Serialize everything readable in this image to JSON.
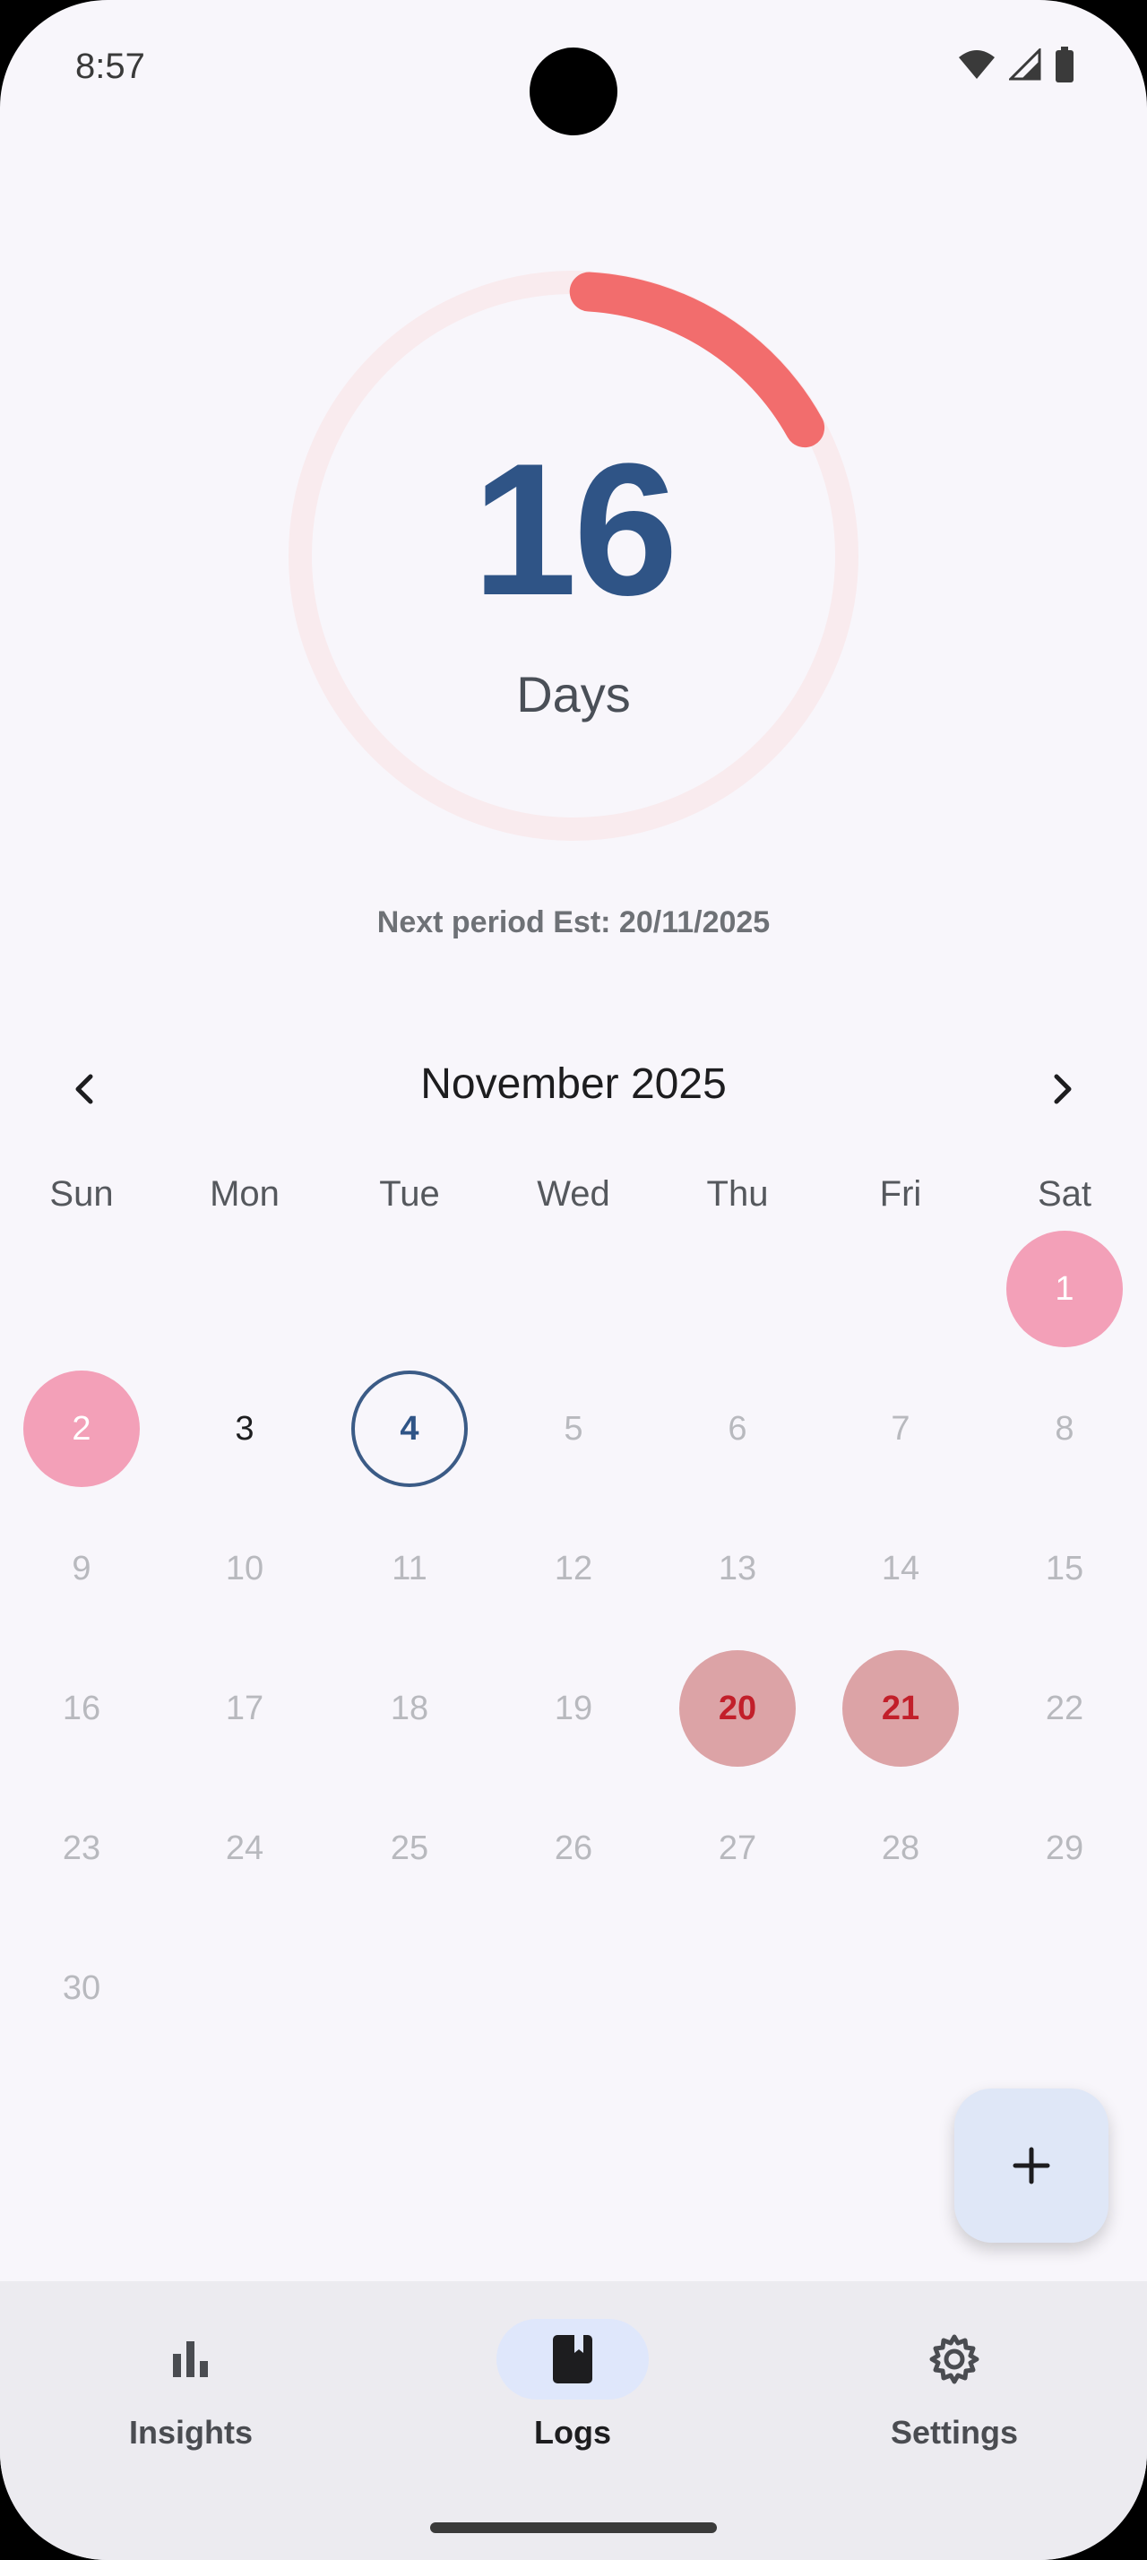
{
  "status_bar": {
    "time": "8:57"
  },
  "cycle": {
    "days_number": "16",
    "days_label": "Days",
    "progress_fraction": 0.16,
    "next_period_text": "Next period Est: 20/11/2025"
  },
  "calendar": {
    "month_title": "November 2025",
    "weekdays": [
      "Sun",
      "Mon",
      "Tue",
      "Wed",
      "Thu",
      "Fri",
      "Sat"
    ],
    "days": [
      "1",
      "2",
      "3",
      "4",
      "5",
      "6",
      "7",
      "8",
      "9",
      "10",
      "11",
      "12",
      "13",
      "14",
      "15",
      "16",
      "17",
      "18",
      "19",
      "20",
      "21",
      "22",
      "23",
      "24",
      "25",
      "26",
      "27",
      "28",
      "29",
      "30"
    ]
  },
  "fab": {
    "icon": "plus-icon"
  },
  "bottom_nav": {
    "items": [
      {
        "label": "Insights",
        "icon": "bar-chart-icon"
      },
      {
        "label": "Logs",
        "icon": "book-icon"
      },
      {
        "label": "Settings",
        "icon": "gear-icon"
      }
    ]
  },
  "colors": {
    "accent_ring": "#f26d6d",
    "ring_track": "#f9ebee",
    "days_number": "#2f5486",
    "period_day": "#f3a0b8",
    "predicted_day": "#dca3a6",
    "predicted_text": "#c21f2a",
    "today_ring": "#3b5b86"
  }
}
